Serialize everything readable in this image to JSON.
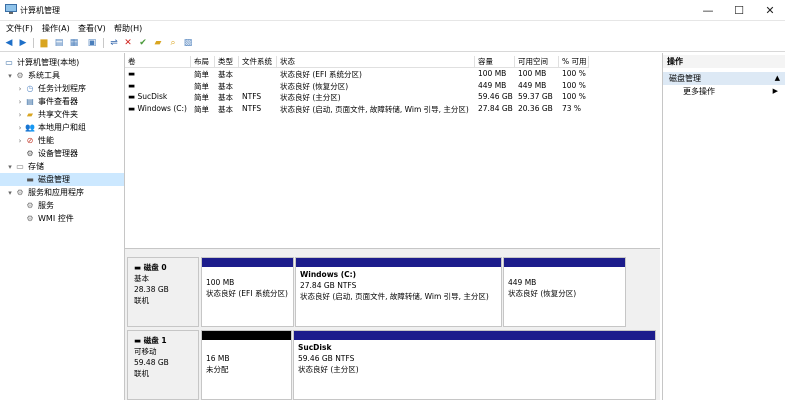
{
  "window": {
    "title": "计算机管理",
    "minimize": "—",
    "maximize": "☐",
    "close": "✕"
  },
  "menu": [
    "文件(F)",
    "操作(A)",
    "查看(V)",
    "帮助(H)"
  ],
  "tree": {
    "root": "计算机管理(本地)",
    "system_tools": "系统工具",
    "task_scheduler": "任务计划程序",
    "event_viewer": "事件查看器",
    "shared_folders": "共享文件夹",
    "local_users": "本地用户和组",
    "performance": "性能",
    "device_manager": "设备管理器",
    "storage": "存储",
    "disk_management": "磁盘管理",
    "services_apps": "服务和应用程序",
    "services": "服务",
    "wmi": "WMI 控件"
  },
  "columns": [
    "卷",
    "布局",
    "类型",
    "文件系统",
    "状态",
    "容量",
    "可用空间",
    "% 可用"
  ],
  "volumes": [
    {
      "name": "",
      "layout": "简单",
      "type": "基本",
      "fs": "",
      "status": "状态良好 (EFI 系统分区)",
      "capacity": "100 MB",
      "free": "100 MB",
      "pct": "100 %"
    },
    {
      "name": "",
      "layout": "简单",
      "type": "基本",
      "fs": "",
      "status": "状态良好 (恢复分区)",
      "capacity": "449 MB",
      "free": "449 MB",
      "pct": "100 %"
    },
    {
      "name": "SucDisk",
      "layout": "简单",
      "type": "基本",
      "fs": "NTFS",
      "status": "状态良好 (主分区)",
      "capacity": "59.46 GB",
      "free": "59.37 GB",
      "pct": "100 %"
    },
    {
      "name": "Windows (C:)",
      "layout": "简单",
      "type": "基本",
      "fs": "NTFS",
      "status": "状态良好 (启动, 页面文件, 故障转储, Wim 引导, 主分区)",
      "capacity": "27.84 GB",
      "free": "20.36 GB",
      "pct": "73 %"
    }
  ],
  "disks": [
    {
      "name": "磁盘 0",
      "kind": "基本",
      "size": "28.38 GB",
      "state": "联机",
      "partitions": [
        {
          "title": "",
          "line1": "100 MB",
          "line2": "状态良好 (EFI 系统分区)"
        },
        {
          "title": "Windows  (C:)",
          "line1": "27.84 GB NTFS",
          "line2": "状态良好 (启动, 页面文件, 故障转储, Wim 引导, 主分区)"
        },
        {
          "title": "",
          "line1": "449 MB",
          "line2": "状态良好 (恢复分区)"
        }
      ]
    },
    {
      "name": "磁盘 1",
      "kind": "可移动",
      "size": "59.48 GB",
      "state": "联机",
      "partitions": [
        {
          "title": "",
          "line1": "16 MB",
          "line2": "未分配"
        },
        {
          "title": "SucDisk",
          "line1": "59.46 GB NTFS",
          "line2": "状态良好 (主分区)"
        }
      ]
    }
  ],
  "actions": {
    "header": "操作",
    "section": "磁盘管理",
    "more": "更多操作"
  },
  "colors": {
    "primary_bar": "#1c1c8c",
    "unallocated_bar": "#000000",
    "selection": "#cce8ff"
  }
}
